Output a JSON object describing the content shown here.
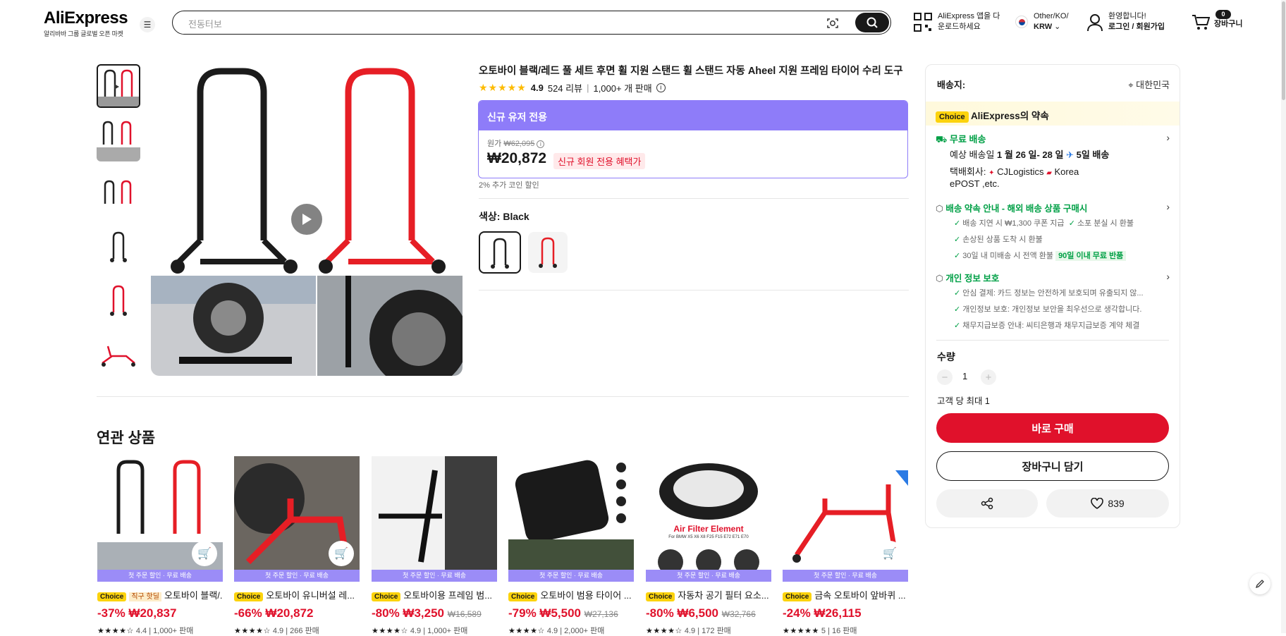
{
  "header": {
    "logo": "AliExpress",
    "logo_tagline": "알리바바 그룹 글로벌 오픈 마켓",
    "search_placeholder": "전동터보",
    "app_line1": "AliExpress 앱을 다",
    "app_line2": "운로드하세요",
    "region_line1": "Other/KO/",
    "region_line2": "KRW",
    "account_line1": "환영합니다!",
    "account_line2": "로그인 / 회원가입",
    "cart_count": "0",
    "cart_label": "장바구니"
  },
  "product": {
    "title": "오토바이 블랙/레드 풀 세트 후면 휠 지원 스탠드 휠 스탠드 자동 Aheel 지원 프레임 타이어 수리 도구",
    "rating": "4.9",
    "reviews": "524 리뷰",
    "sold": "1,000+ 개 판매",
    "promo_banner": "신규 유저 전용",
    "original_label": "원가",
    "original_price": "₩62,095",
    "price": "₩20,872",
    "price_badge": "신규 회원 전용 혜택가",
    "coin_discount": "2% 추가 코인 할인",
    "color_label": "색상:",
    "color_value": "Black"
  },
  "panel": {
    "ship_to": "배송지:",
    "ship_location": "대한민국",
    "choice_tag": "Choice",
    "choice_promise": "AliExpress의 약속",
    "free_shipping": "무료 배송",
    "eta_prefix": "예상 배송일",
    "eta_dates": "1 월 26 일- 28 일",
    "eta_days": "5일 배송",
    "carrier_label": "택배회사:",
    "carrier1": "CJLogistics",
    "carrier2a": "Korea",
    "carrier2b": "ePOST ,etc.",
    "guarantee_title": "배송 약속 안내 - 해외 배송 상품 구매시",
    "g1": "배송 지연 시 ₩1,300 쿠폰 지급",
    "g2": "소포 분실 시 환불",
    "g3": "손상된 상품 도착 시 환불",
    "g4": "30일 내 미배송 시 전액 환불",
    "g5": "90일 이내 무료 반품",
    "privacy_title": "개인 정보 보호",
    "p1": "안심 결제: 카드 정보는 안전하게 보호되며 유출되지 않...",
    "p2": "개인정보 보호: 개인정보 보안을 최우선으로 생각합니다.",
    "p3": "채무지급보증 안내: 씨티은행과 채무지급보증 계약 체결",
    "qty_label": "수량",
    "qty_value": "1",
    "qty_max": "고객 당 최대 1",
    "buy_now": "바로 구매",
    "add_to_cart": "장바구니 담기",
    "wishlist_count": "839"
  },
  "related": {
    "title": "연관 상품",
    "strip": "첫 주문 할인 · 무료 배송",
    "items": [
      {
        "choice": "Choice",
        "deal": "직구 핫딜",
        "name": "오토바이 블랙/...",
        "discount": "-37%",
        "price": "₩20,837",
        "old": "",
        "rating": "4.4",
        "sold": "1,000+ 판매"
      },
      {
        "choice": "Choice",
        "deal": "",
        "name": "오토바이 유니버설 레...",
        "discount": "-66%",
        "price": "₩20,872",
        "old": "",
        "rating": "4.9",
        "sold": "266 판매"
      },
      {
        "choice": "Choice",
        "deal": "",
        "name": "오토바이용 프레임 범...",
        "discount": "-80%",
        "price": "₩3,250",
        "old": "₩16,589",
        "rating": "4.9",
        "sold": "1,000+ 판매"
      },
      {
        "choice": "Choice",
        "deal": "",
        "name": "오토바이 범용 타이어 ...",
        "discount": "-79%",
        "price": "₩5,500",
        "old": "₩27,136",
        "rating": "4.9",
        "sold": "2,000+ 판매"
      },
      {
        "choice": "Choice",
        "deal": "",
        "name": "자동차 공기 필터 요소...",
        "discount": "-80%",
        "price": "₩6,500",
        "old": "₩32,766",
        "rating": "4.9",
        "sold": "172 판매"
      },
      {
        "choice": "Choice",
        "deal": "",
        "name": "금속 오토바이 앞바퀴 ...",
        "discount": "-24%",
        "price": "₩26,115",
        "old": "",
        "rating": "5",
        "sold": "16 판매"
      }
    ],
    "img2_label": "Air Filter Element",
    "img2_sub": "For BMW X5 X6 X8 F25 F15 E72 E71 E70"
  },
  "colors": {
    "accent": "#e0112b",
    "promo": "#8e7cf9",
    "choice": "#fcd30d",
    "green": "#00a046"
  }
}
